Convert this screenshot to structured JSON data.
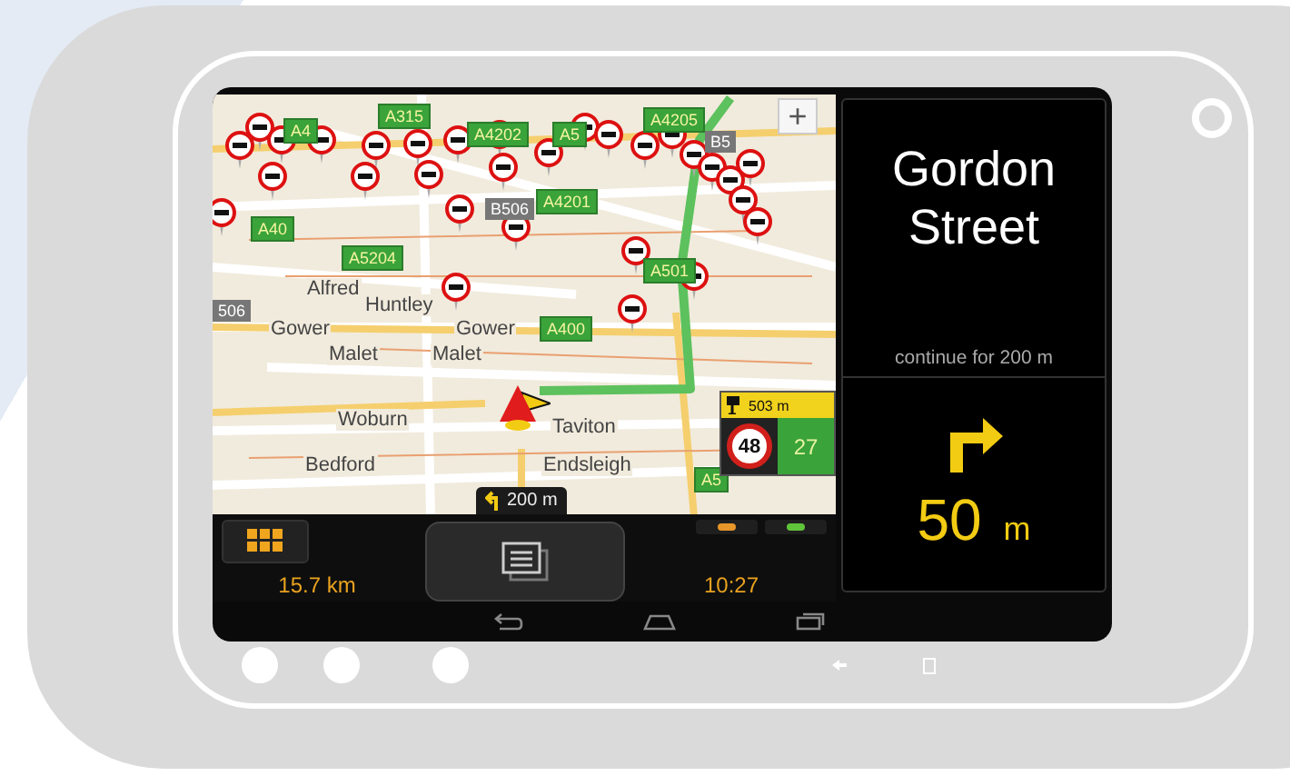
{
  "map": {
    "labels": [
      {
        "kind": "a-road",
        "text": "A315"
      },
      {
        "kind": "a-road",
        "text": "A4"
      },
      {
        "kind": "a-road",
        "text": "A4202"
      },
      {
        "kind": "a-road",
        "text": "A5"
      },
      {
        "kind": "a-road",
        "text": "A4205"
      },
      {
        "kind": "b-road",
        "text": "B5"
      },
      {
        "kind": "b-road",
        "text": "B506"
      },
      {
        "kind": "a-road",
        "text": "A4201"
      },
      {
        "kind": "a-road",
        "text": "A40"
      },
      {
        "kind": "a-road",
        "text": "A5204"
      },
      {
        "kind": "a-road",
        "text": "A501"
      },
      {
        "kind": "b-road",
        "text": "506"
      },
      {
        "kind": "a-road",
        "text": "A400"
      },
      {
        "kind": "a-road",
        "text": "A5"
      },
      {
        "kind": "street",
        "text": "Alfred"
      },
      {
        "kind": "street",
        "text": "Huntley"
      },
      {
        "kind": "street",
        "text": "Gower"
      },
      {
        "kind": "street",
        "text": "Gower"
      },
      {
        "kind": "street",
        "text": "Malet"
      },
      {
        "kind": "street",
        "text": "Malet"
      },
      {
        "kind": "street",
        "text": "Woburn"
      },
      {
        "kind": "street",
        "text": "Taviton"
      },
      {
        "kind": "street",
        "text": "Bedford"
      },
      {
        "kind": "street",
        "text": "Endsleigh"
      }
    ],
    "zoom_button": "+",
    "turn_hint": "200 m",
    "speed_camera": {
      "distance": "503 m",
      "speed_limit": "48",
      "current_speed": "27"
    }
  },
  "dashboard": {
    "distance": "15.7 km",
    "time": "10:27"
  },
  "instruction": {
    "street": "Gordon Street",
    "subtext": "continue for 200 m",
    "distance": "50",
    "unit": "m"
  }
}
